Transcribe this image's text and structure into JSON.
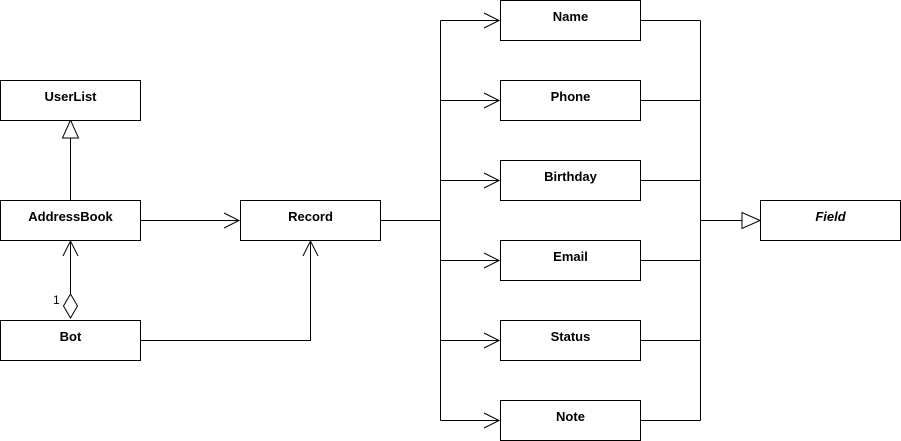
{
  "diagram": {
    "type": "uml-class-diagram",
    "classes": {
      "userlist": "UserList",
      "addressbook": "AddressBook",
      "bot": "Bot",
      "record": "Record",
      "name": "Name",
      "phone": "Phone",
      "birthday": "Birthday",
      "email": "Email",
      "status": "Status",
      "note": "Note",
      "field": "Field"
    },
    "multiplicities": {
      "bot_addressbook": "1"
    },
    "relations": [
      {
        "from": "AddressBook",
        "to": "UserList",
        "kind": "inheritance"
      },
      {
        "from": "Bot",
        "to": "AddressBook",
        "kind": "aggregation"
      },
      {
        "from": "AddressBook",
        "to": "Record",
        "kind": "association"
      },
      {
        "from": "Bot",
        "to": "Record",
        "kind": "association"
      },
      {
        "from": "Record",
        "to": "Name",
        "kind": "association"
      },
      {
        "from": "Record",
        "to": "Phone",
        "kind": "association"
      },
      {
        "from": "Record",
        "to": "Birthday",
        "kind": "association"
      },
      {
        "from": "Record",
        "to": "Email",
        "kind": "association"
      },
      {
        "from": "Record",
        "to": "Status",
        "kind": "association"
      },
      {
        "from": "Record",
        "to": "Note",
        "kind": "association"
      },
      {
        "from": "Name",
        "to": "Field",
        "kind": "inheritance"
      },
      {
        "from": "Phone",
        "to": "Field",
        "kind": "inheritance"
      },
      {
        "from": "Birthday",
        "to": "Field",
        "kind": "inheritance"
      },
      {
        "from": "Email",
        "to": "Field",
        "kind": "inheritance"
      },
      {
        "from": "Status",
        "to": "Field",
        "kind": "inheritance"
      },
      {
        "from": "Note",
        "to": "Field",
        "kind": "inheritance"
      }
    ]
  }
}
